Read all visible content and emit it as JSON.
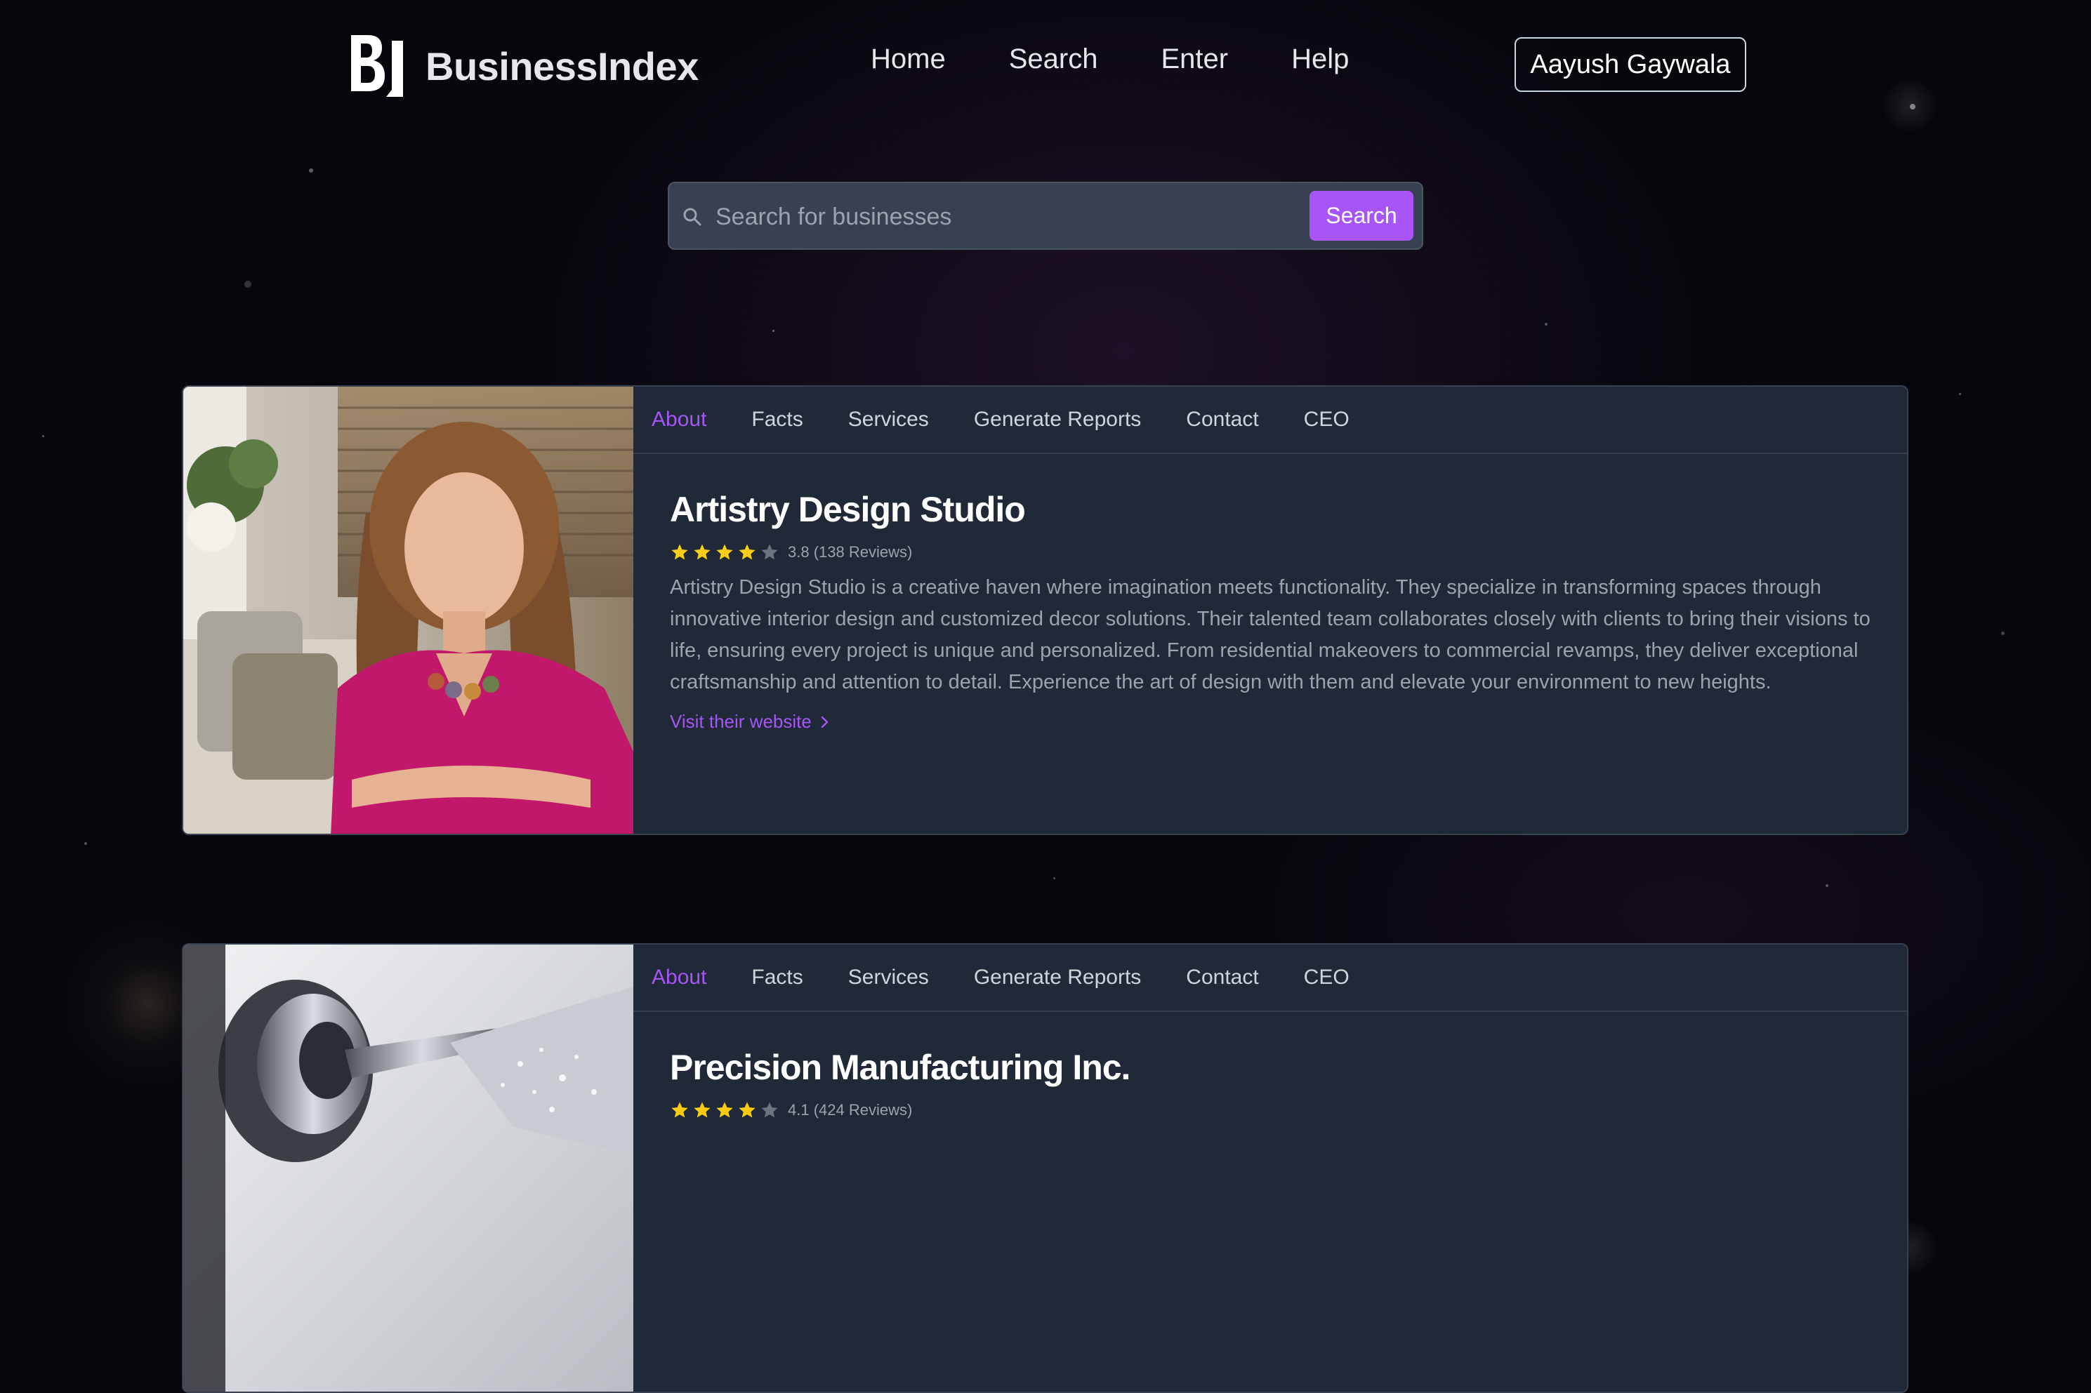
{
  "app": {
    "brand": "BusinessIndex",
    "nav": [
      {
        "label": "Home"
      },
      {
        "label": "Search"
      },
      {
        "label": "Enter"
      },
      {
        "label": "Help"
      }
    ],
    "user_name": "Aayush Gaywala"
  },
  "search": {
    "placeholder": "Search for businesses",
    "value": "",
    "button_label": "Search"
  },
  "businesses": [
    {
      "tabs": [
        "About",
        "Facts",
        "Services",
        "Generate Reports",
        "Contact",
        "CEO"
      ],
      "active_tab": "About",
      "name": "Artistry Design Studio",
      "rating": 3.8,
      "rating_text": "3.8 (138 Reviews)",
      "stars_filled": 4,
      "description": "Artistry Design Studio is a creative haven where imagination meets functionality. They specialize in transforming spaces through innovative interior design and customized decor solutions. Their talented team collaborates closely with clients to bring their visions to life, ensuring every project is unique and personalized. From residential makeovers to commercial revamps, they deliver exceptional craftsmanship and attention to detail. Experience the art of design with them and elevate your environment to new heights.",
      "link_label": "Visit their website"
    },
    {
      "tabs": [
        "About",
        "Facts",
        "Services",
        "Generate Reports",
        "Contact",
        "CEO"
      ],
      "active_tab": "About",
      "name": "Precision Manufacturing Inc.",
      "rating": 4.1,
      "rating_text": "4.1 (424 Reviews)",
      "stars_filled": 4
    }
  ],
  "colors": {
    "accent": "#a855f7",
    "card_bg": "#1f2937",
    "star_filled": "#facc15",
    "star_empty": "#6b7280"
  }
}
